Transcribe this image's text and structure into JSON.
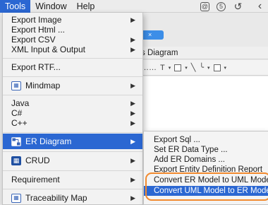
{
  "menubar": {
    "items": [
      "Tools",
      "Window",
      "Help"
    ],
    "active_index": 0,
    "tray": [
      "@",
      "5",
      "↺",
      "‹"
    ]
  },
  "background": {
    "tab_close": "×",
    "diagram_header": "s Diagram",
    "toolbar": [
      "……",
      "T",
      "▾",
      "▾",
      "╲",
      "╰",
      "▾",
      "▾"
    ]
  },
  "tools_menu": {
    "items": [
      {
        "label": "Export Image",
        "submenu": true
      },
      {
        "label": "Export Html ...",
        "submenu": false
      },
      {
        "label": "Export CSV",
        "submenu": true
      },
      {
        "label": "XML Input & Output",
        "submenu": true
      },
      {
        "label": "Export RTF...",
        "submenu": false
      },
      {
        "label": "Mindmap",
        "submenu": true,
        "icon": "mindmap-icon"
      },
      {
        "label": "Java",
        "submenu": true
      },
      {
        "label": "C#",
        "submenu": true
      },
      {
        "label": "C++",
        "submenu": true
      },
      {
        "label": "ER Diagram",
        "submenu": true,
        "icon": "er-diagram-icon",
        "active": true
      },
      {
        "label": "CRUD",
        "submenu": true,
        "icon": "crud-icon"
      },
      {
        "label": "Requirement",
        "submenu": true
      },
      {
        "label": "Traceability Map",
        "submenu": true,
        "icon": "traceability-map-icon"
      }
    ],
    "arrow_glyph": "▶"
  },
  "er_submenu": {
    "items": [
      {
        "label": "Export Sql ..."
      },
      {
        "label": "Set ER Data Type ..."
      },
      {
        "label": "Add ER Domains ..."
      },
      {
        "label": "Export Entity Definition Report"
      },
      {
        "label": "Convert ER Model to UML Model"
      },
      {
        "label": "Convert UML Model to ER Model",
        "active": true
      }
    ]
  },
  "colors": {
    "menu_highlight": "#2b67d2",
    "annotation_box": "#f28a2e",
    "tab_blue": "#3c8ee8"
  }
}
